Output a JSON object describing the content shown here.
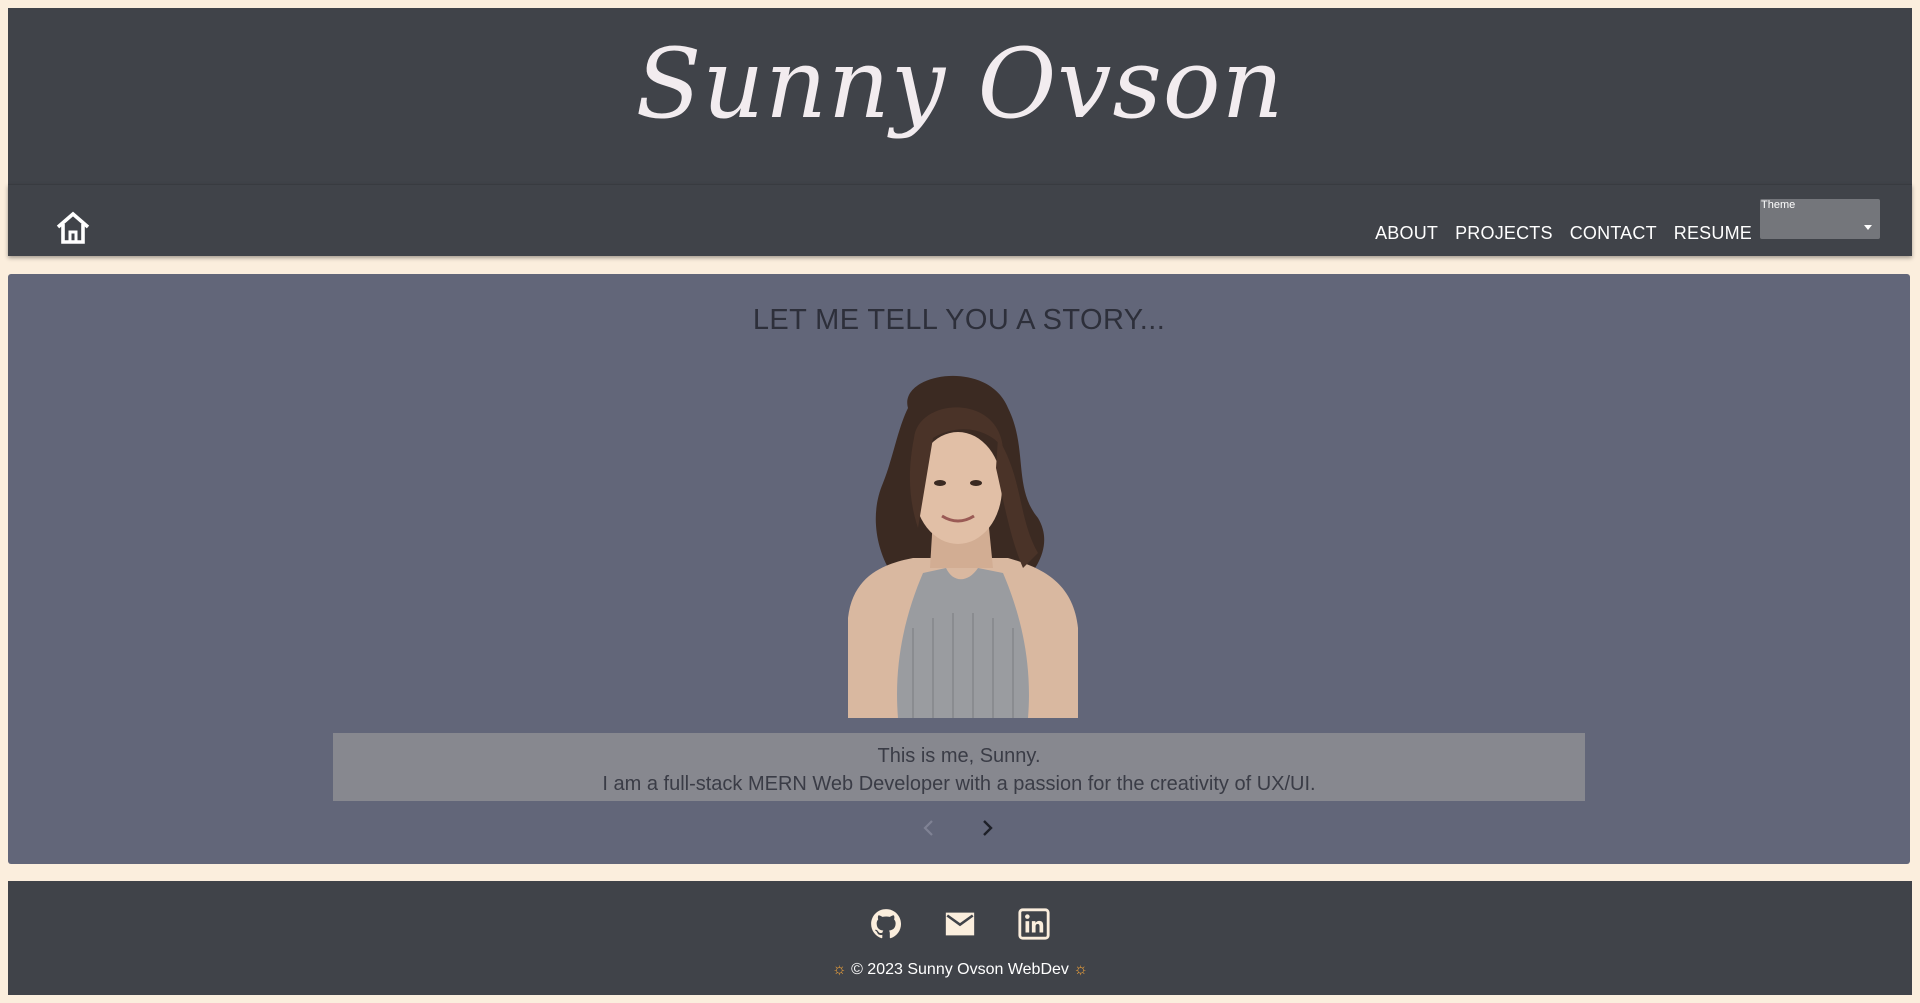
{
  "header": {
    "logo_text": "Sunny Ovson"
  },
  "nav": {
    "home_icon": "home-icon",
    "links": [
      "ABOUT",
      "PROJECTS",
      "CONTACT",
      "RESUME"
    ],
    "theme_label": "Theme",
    "theme_value": ""
  },
  "main": {
    "title": "LET ME TELL YOU A STORY...",
    "caption_line1": "This is me, Sunny.",
    "caption_line2": "I am a full-stack MERN Web Developer with a passion for the creativity of UX/UI."
  },
  "footer": {
    "icons": [
      "github-icon",
      "email-icon",
      "linkedin-icon"
    ],
    "sun_left": "☼",
    "copyright": " © 2023 Sunny Ovson WebDev ",
    "sun_right": "☼"
  },
  "colors": {
    "page_bg": "#fbeedd",
    "header_bg": "#404349",
    "main_bg": "#626679",
    "caption_bg": "#87888f",
    "accent_sun": "#f0a23a"
  }
}
